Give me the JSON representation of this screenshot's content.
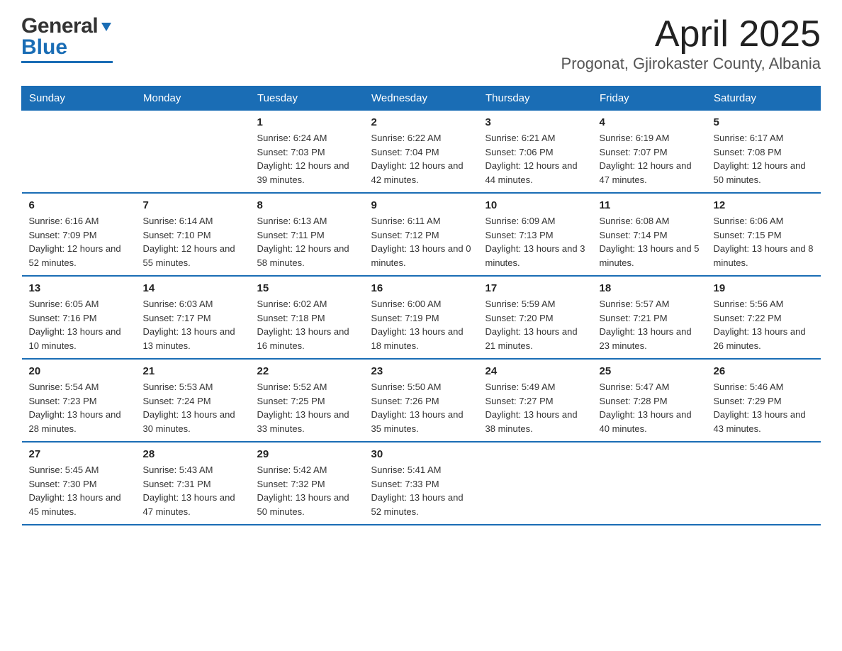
{
  "header": {
    "title": "April 2025",
    "subtitle": "Progonat, Gjirokaster County, Albania",
    "logo_general": "General",
    "logo_blue": "Blue"
  },
  "calendar": {
    "days": [
      "Sunday",
      "Monday",
      "Tuesday",
      "Wednesday",
      "Thursday",
      "Friday",
      "Saturday"
    ],
    "weeks": [
      [
        {
          "date": "",
          "sunrise": "",
          "sunset": "",
          "daylight": ""
        },
        {
          "date": "",
          "sunrise": "",
          "sunset": "",
          "daylight": ""
        },
        {
          "date": "1",
          "sunrise": "Sunrise: 6:24 AM",
          "sunset": "Sunset: 7:03 PM",
          "daylight": "Daylight: 12 hours and 39 minutes."
        },
        {
          "date": "2",
          "sunrise": "Sunrise: 6:22 AM",
          "sunset": "Sunset: 7:04 PM",
          "daylight": "Daylight: 12 hours and 42 minutes."
        },
        {
          "date": "3",
          "sunrise": "Sunrise: 6:21 AM",
          "sunset": "Sunset: 7:06 PM",
          "daylight": "Daylight: 12 hours and 44 minutes."
        },
        {
          "date": "4",
          "sunrise": "Sunrise: 6:19 AM",
          "sunset": "Sunset: 7:07 PM",
          "daylight": "Daylight: 12 hours and 47 minutes."
        },
        {
          "date": "5",
          "sunrise": "Sunrise: 6:17 AM",
          "sunset": "Sunset: 7:08 PM",
          "daylight": "Daylight: 12 hours and 50 minutes."
        }
      ],
      [
        {
          "date": "6",
          "sunrise": "Sunrise: 6:16 AM",
          "sunset": "Sunset: 7:09 PM",
          "daylight": "Daylight: 12 hours and 52 minutes."
        },
        {
          "date": "7",
          "sunrise": "Sunrise: 6:14 AM",
          "sunset": "Sunset: 7:10 PM",
          "daylight": "Daylight: 12 hours and 55 minutes."
        },
        {
          "date": "8",
          "sunrise": "Sunrise: 6:13 AM",
          "sunset": "Sunset: 7:11 PM",
          "daylight": "Daylight: 12 hours and 58 minutes."
        },
        {
          "date": "9",
          "sunrise": "Sunrise: 6:11 AM",
          "sunset": "Sunset: 7:12 PM",
          "daylight": "Daylight: 13 hours and 0 minutes."
        },
        {
          "date": "10",
          "sunrise": "Sunrise: 6:09 AM",
          "sunset": "Sunset: 7:13 PM",
          "daylight": "Daylight: 13 hours and 3 minutes."
        },
        {
          "date": "11",
          "sunrise": "Sunrise: 6:08 AM",
          "sunset": "Sunset: 7:14 PM",
          "daylight": "Daylight: 13 hours and 5 minutes."
        },
        {
          "date": "12",
          "sunrise": "Sunrise: 6:06 AM",
          "sunset": "Sunset: 7:15 PM",
          "daylight": "Daylight: 13 hours and 8 minutes."
        }
      ],
      [
        {
          "date": "13",
          "sunrise": "Sunrise: 6:05 AM",
          "sunset": "Sunset: 7:16 PM",
          "daylight": "Daylight: 13 hours and 10 minutes."
        },
        {
          "date": "14",
          "sunrise": "Sunrise: 6:03 AM",
          "sunset": "Sunset: 7:17 PM",
          "daylight": "Daylight: 13 hours and 13 minutes."
        },
        {
          "date": "15",
          "sunrise": "Sunrise: 6:02 AM",
          "sunset": "Sunset: 7:18 PM",
          "daylight": "Daylight: 13 hours and 16 minutes."
        },
        {
          "date": "16",
          "sunrise": "Sunrise: 6:00 AM",
          "sunset": "Sunset: 7:19 PM",
          "daylight": "Daylight: 13 hours and 18 minutes."
        },
        {
          "date": "17",
          "sunrise": "Sunrise: 5:59 AM",
          "sunset": "Sunset: 7:20 PM",
          "daylight": "Daylight: 13 hours and 21 minutes."
        },
        {
          "date": "18",
          "sunrise": "Sunrise: 5:57 AM",
          "sunset": "Sunset: 7:21 PM",
          "daylight": "Daylight: 13 hours and 23 minutes."
        },
        {
          "date": "19",
          "sunrise": "Sunrise: 5:56 AM",
          "sunset": "Sunset: 7:22 PM",
          "daylight": "Daylight: 13 hours and 26 minutes."
        }
      ],
      [
        {
          "date": "20",
          "sunrise": "Sunrise: 5:54 AM",
          "sunset": "Sunset: 7:23 PM",
          "daylight": "Daylight: 13 hours and 28 minutes."
        },
        {
          "date": "21",
          "sunrise": "Sunrise: 5:53 AM",
          "sunset": "Sunset: 7:24 PM",
          "daylight": "Daylight: 13 hours and 30 minutes."
        },
        {
          "date": "22",
          "sunrise": "Sunrise: 5:52 AM",
          "sunset": "Sunset: 7:25 PM",
          "daylight": "Daylight: 13 hours and 33 minutes."
        },
        {
          "date": "23",
          "sunrise": "Sunrise: 5:50 AM",
          "sunset": "Sunset: 7:26 PM",
          "daylight": "Daylight: 13 hours and 35 minutes."
        },
        {
          "date": "24",
          "sunrise": "Sunrise: 5:49 AM",
          "sunset": "Sunset: 7:27 PM",
          "daylight": "Daylight: 13 hours and 38 minutes."
        },
        {
          "date": "25",
          "sunrise": "Sunrise: 5:47 AM",
          "sunset": "Sunset: 7:28 PM",
          "daylight": "Daylight: 13 hours and 40 minutes."
        },
        {
          "date": "26",
          "sunrise": "Sunrise: 5:46 AM",
          "sunset": "Sunset: 7:29 PM",
          "daylight": "Daylight: 13 hours and 43 minutes."
        }
      ],
      [
        {
          "date": "27",
          "sunrise": "Sunrise: 5:45 AM",
          "sunset": "Sunset: 7:30 PM",
          "daylight": "Daylight: 13 hours and 45 minutes."
        },
        {
          "date": "28",
          "sunrise": "Sunrise: 5:43 AM",
          "sunset": "Sunset: 7:31 PM",
          "daylight": "Daylight: 13 hours and 47 minutes."
        },
        {
          "date": "29",
          "sunrise": "Sunrise: 5:42 AM",
          "sunset": "Sunset: 7:32 PM",
          "daylight": "Daylight: 13 hours and 50 minutes."
        },
        {
          "date": "30",
          "sunrise": "Sunrise: 5:41 AM",
          "sunset": "Sunset: 7:33 PM",
          "daylight": "Daylight: 13 hours and 52 minutes."
        },
        {
          "date": "",
          "sunrise": "",
          "sunset": "",
          "daylight": ""
        },
        {
          "date": "",
          "sunrise": "",
          "sunset": "",
          "daylight": ""
        },
        {
          "date": "",
          "sunrise": "",
          "sunset": "",
          "daylight": ""
        }
      ]
    ]
  }
}
